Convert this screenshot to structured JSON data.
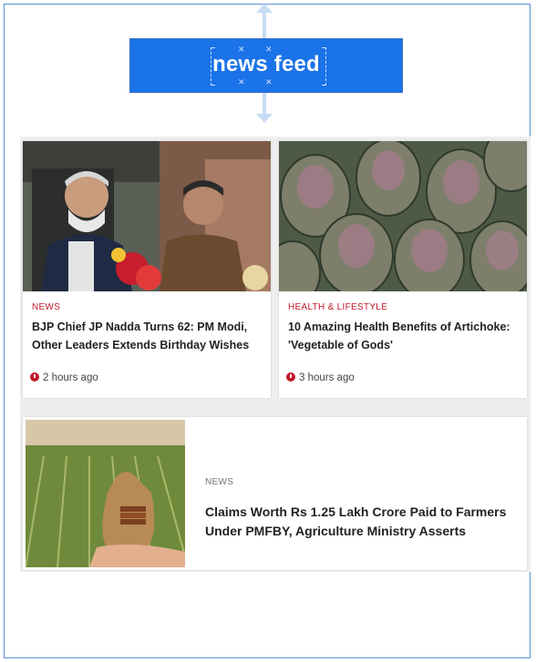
{
  "header": {
    "title": "news feed"
  },
  "articles": [
    {
      "category": "NEWS",
      "headline": "BJP Chief JP Nadda Turns 62: PM Modi, Other Leaders Extends Birthday Wishes",
      "time": "2 hours ago"
    },
    {
      "category": "HEALTH & LIFESTYLE",
      "headline": "10 Amazing Health Benefits of Artichoke: 'Vegetable of Gods'",
      "time": "3 hours ago"
    },
    {
      "category": "NEWS",
      "headline": "Claims Worth Rs 1.25 Lakh Crore Paid to Farmers Under PMFBY, Agriculture Ministry Asserts"
    }
  ],
  "colors": {
    "header_bg": "#1a73e8",
    "category_red": "#c0182b",
    "frame_border": "#5b8ed6"
  },
  "icons": {
    "time": "clock-icon",
    "resize": "resize-arrow-icon"
  }
}
